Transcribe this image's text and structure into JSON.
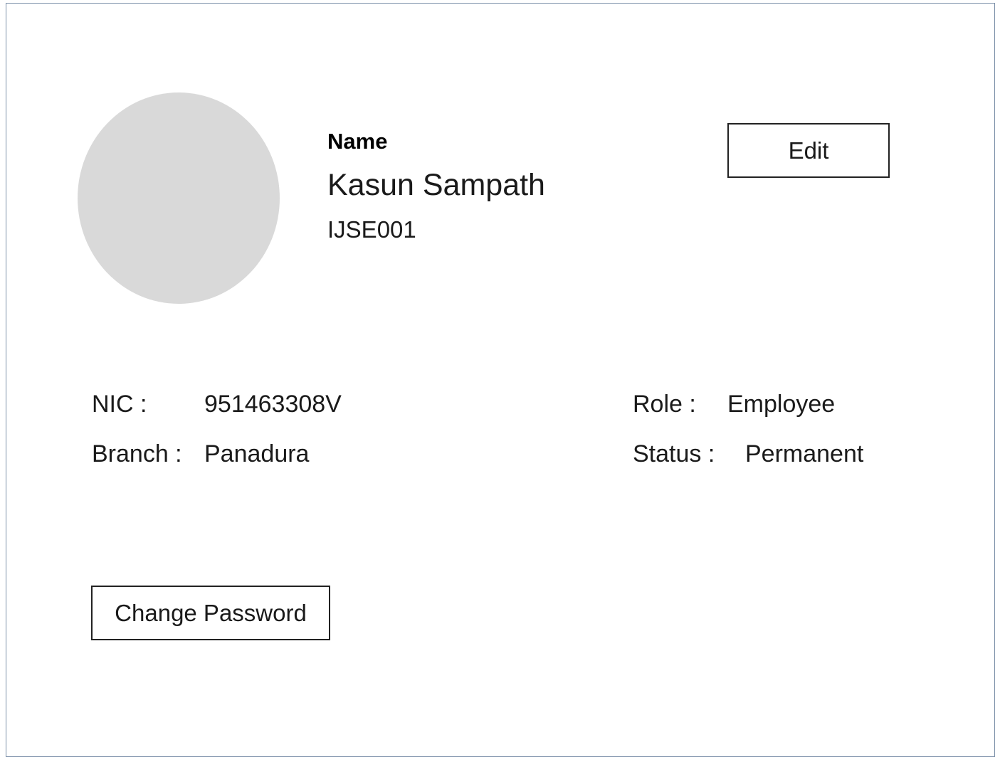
{
  "profile": {
    "name_label": "Name",
    "name": "Kasun Sampath",
    "employee_id": "IJSE001",
    "edit_label": "Edit"
  },
  "details": {
    "nic_label": "NIC :",
    "nic": "951463308V",
    "branch_label": "Branch :",
    "branch": "Panadura",
    "role_label": "Role :",
    "role": "Employee",
    "status_label": "Status :",
    "status": "Permanent"
  },
  "actions": {
    "change_password_label": "Change Password"
  },
  "colors": {
    "avatar_placeholder": "#d9d9d9",
    "frame_border": "#7b8fa8",
    "button_border": "#222222"
  }
}
